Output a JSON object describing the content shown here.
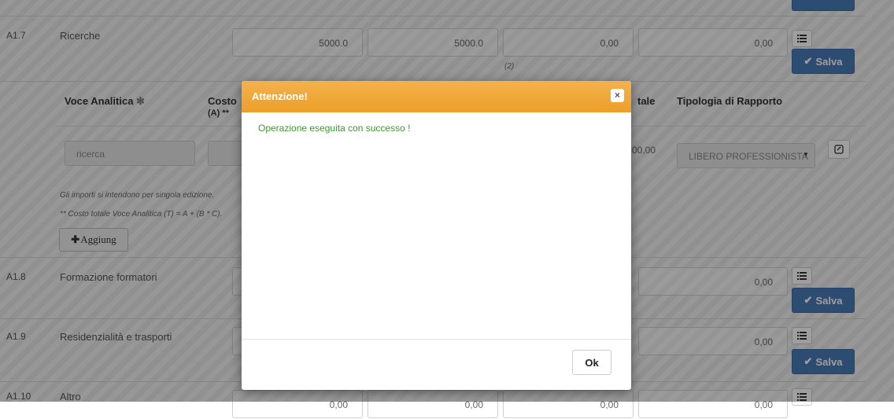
{
  "rows": [
    {
      "code": "A1.7",
      "label": "Ricerche",
      "v1": "5000.0",
      "v2": "5000.0",
      "v3": "0,00",
      "v4": "0,00",
      "note": "(2)",
      "save": "Salva"
    },
    {
      "code": "A1.8",
      "label": "Formazione formatori",
      "v4": "0,00",
      "save": "Salva"
    },
    {
      "code": "A1.9",
      "label": "Residenzialità e trasporti",
      "v4": "0,00",
      "save": "Salva"
    },
    {
      "code": "A1.10",
      "label": "Altro",
      "v1": "0,00",
      "v2": "0,00",
      "v3": "0,00",
      "v4": "0,00"
    }
  ],
  "detail": {
    "headers": {
      "voce": "Voce Analitica",
      "costo": "Costo",
      "costo_sub": "(A) **",
      "totale": "tale",
      "tipologia": "Tipologia di Rapporto"
    },
    "voce_value": "ricerca",
    "totale_value": "00,00",
    "tipologia_value": "LIBERO PROFESSIONISTA",
    "note1": "Gli importi si intendono per singola edizione.",
    "note2": "** Costo totale Voce Analitica (T) = A + (B * C).",
    "add_label": "Aggiung"
  },
  "modal": {
    "title": "Attenzione!",
    "message": "Operazione eseguita con successo !",
    "ok": "Ok",
    "close": "×"
  },
  "colors": {
    "header": "#f0a93a",
    "success": "#3a9a2d",
    "save": "#4a7bb7"
  }
}
